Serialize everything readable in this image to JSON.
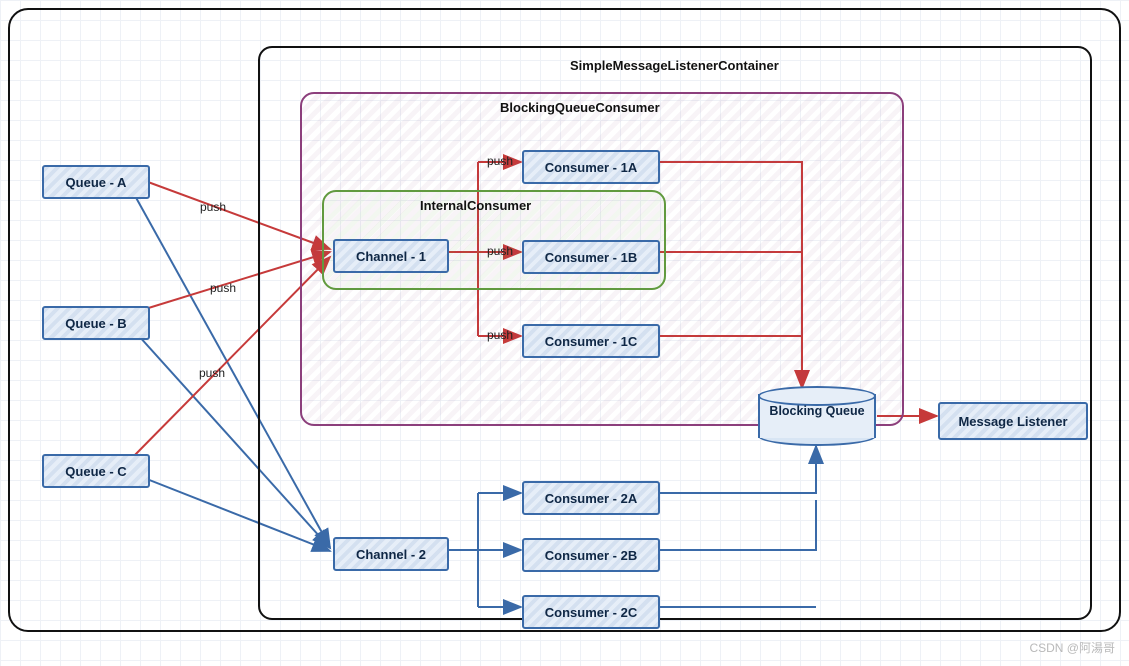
{
  "containers": {
    "smlc": "SimpleMessageListenerContainer",
    "bqc": "BlockingQueueConsumer",
    "intc": "InternalConsumer"
  },
  "queues": {
    "a": "Queue - A",
    "b": "Queue - B",
    "c": "Queue - C"
  },
  "channels": {
    "c1": "Channel - 1",
    "c2": "Channel - 2"
  },
  "consumers": {
    "c1a": "Consumer - 1A",
    "c1b": "Consumer - 1B",
    "c1c": "Consumer - 1C",
    "c2a": "Consumer - 2A",
    "c2b": "Consumer - 2B",
    "c2c": "Consumer - 2C"
  },
  "blocking_queue": "Blocking Queue",
  "listener": "Message Listener",
  "push_label": "push",
  "watermark": "CSDN @阿湯哥",
  "colors": {
    "blue": "#3a6aa8",
    "red": "#c63a3a",
    "purple": "#8c3f7c",
    "green": "#619a3f",
    "black": "#111"
  }
}
